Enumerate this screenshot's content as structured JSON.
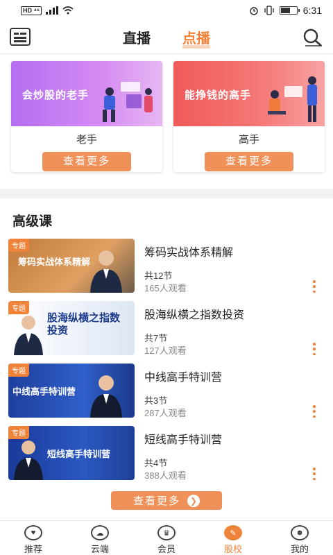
{
  "status_bar": {
    "left": "HD ⁴⁶",
    "time": "6:31",
    "battery_level": 0.55
  },
  "header": {
    "tabs": [
      {
        "label": "直播",
        "active": false
      },
      {
        "label": "点播",
        "active": true
      }
    ],
    "menu_icon": "list-menu-icon",
    "search_icon": "search-icon"
  },
  "cards": [
    {
      "slogan": "会炒股的老手",
      "caption": "老手",
      "button": "查看更多",
      "color": "#c77cf1"
    },
    {
      "slogan": "能挣钱的高手",
      "caption": "高手",
      "button": "查看更多",
      "color": "#f26664"
    }
  ],
  "section": {
    "title": "高级课"
  },
  "courses": [
    {
      "tag": "专题",
      "thumb_text": "筹码实战体系精解",
      "title": "筹码实战体系精解",
      "sections": "共12节",
      "views": "165人观看"
    },
    {
      "tag": "专题",
      "thumb_text": "股海纵横之指数投资",
      "title": "股海纵横之指数投资",
      "sections": "共7节",
      "views": "127人观看"
    },
    {
      "tag": "专题",
      "thumb_text": "中线高手特训营",
      "title": "中线高手特训营",
      "sections": "共3节",
      "views": "287人观看"
    },
    {
      "tag": "专题",
      "thumb_text": "短线高手特训营",
      "title": "短线高手特训营",
      "sections": "共4节",
      "views": "388人观看"
    }
  ],
  "load_more": {
    "label": "查看更多",
    "icon": "chevron-right-icon"
  },
  "bottom_nav": [
    {
      "label": "推荐",
      "icon": "heart-icon",
      "active": false
    },
    {
      "label": "云端",
      "icon": "cloud-icon",
      "active": false
    },
    {
      "label": "会员",
      "icon": "crown-icon",
      "active": false
    },
    {
      "label": "股校",
      "icon": "school-icon",
      "active": true
    },
    {
      "label": "我的",
      "icon": "user-icon",
      "active": false
    }
  ],
  "colors": {
    "accent": "#f0833a",
    "button": "#f0915a"
  }
}
